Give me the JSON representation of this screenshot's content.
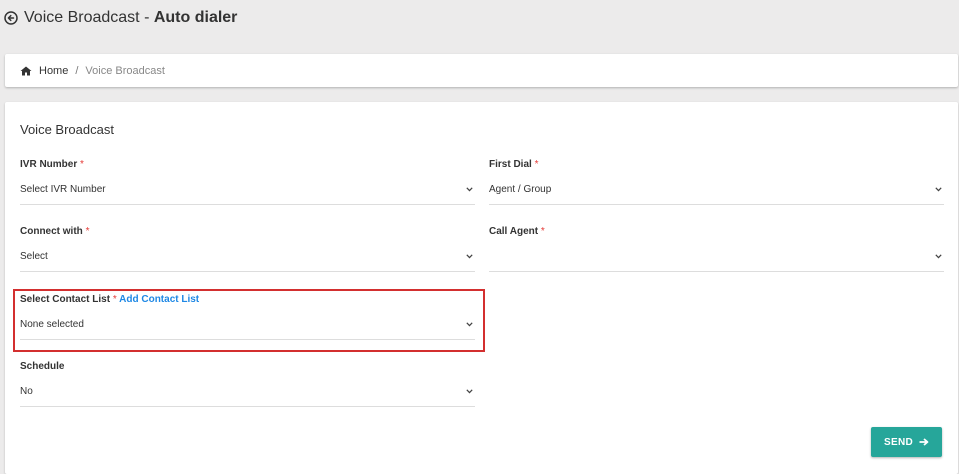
{
  "header": {
    "back_icon": "arrow-left-circle-icon",
    "title_main": "Voice Broadcast - ",
    "title_bold": "Auto dialer"
  },
  "breadcrumb": {
    "home_icon": "home-icon",
    "home": "Home",
    "separator": "/",
    "current": "Voice Broadcast"
  },
  "form": {
    "title": "Voice Broadcast",
    "required_mark": "*",
    "ivr_number": {
      "label": "IVR Number",
      "value": "Select IVR Number"
    },
    "first_dial": {
      "label": "First Dial",
      "value": "Agent / Group"
    },
    "connect_with": {
      "label": "Connect with",
      "value": "Select"
    },
    "call_agent": {
      "label": "Call Agent",
      "value": ""
    },
    "contact_list": {
      "label": "Select Contact List",
      "add_link": "Add Contact List",
      "value": "None selected"
    },
    "schedule": {
      "label": "Schedule",
      "value": "No"
    },
    "send_label": "SEND"
  },
  "colors": {
    "accent": "#26a69a",
    "link": "#1e88e5",
    "required": "#e53935",
    "highlight": "#d32f2f"
  }
}
